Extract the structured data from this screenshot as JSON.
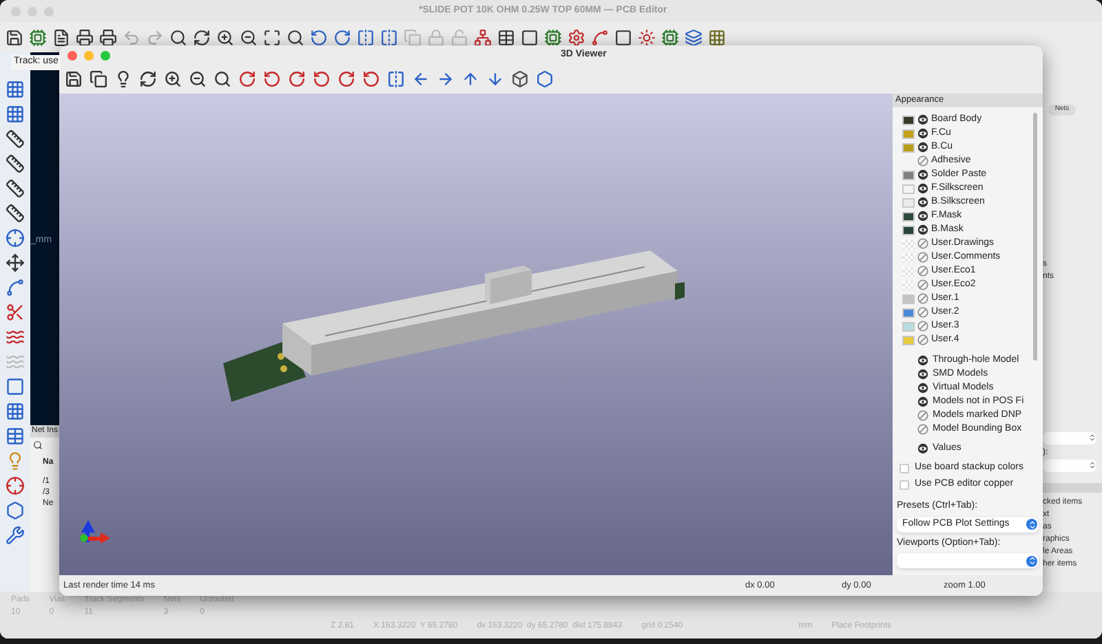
{
  "pcb_editor": {
    "title": "*SLIDE POT 10K OHM 0.25W TOP 60MM — PCB Editor",
    "tooltip": "Track: use",
    "canvas_label": "_mm",
    "net_inspector": {
      "title": "Net Ins",
      "column": "Na",
      "rows": [
        "/1",
        "/3",
        "Ne"
      ]
    },
    "right_panel": {
      "tab": "Nets",
      "fragments": [
        "s",
        "nts"
      ],
      "select_label": "):",
      "list_fragments": [
        "cked items",
        "xt",
        "as",
        "raphics",
        "le Areas",
        "her items"
      ]
    },
    "stats": [
      {
        "label": "Pads",
        "value": "10"
      },
      {
        "label": "Vias",
        "value": "0"
      },
      {
        "label": "Track Segments",
        "value": "11"
      },
      {
        "label": "Nets",
        "value": "3"
      },
      {
        "label": "Unrouted",
        "value": "0"
      }
    ],
    "status": [
      "Z 2.81",
      "X 163.3220  Y 65.2780",
      "dx 163.3220  dy 65.2780  dist 175.8843",
      "grid 0.2540",
      "mm",
      "Place Footprints"
    ]
  },
  "viewer": {
    "title": "3D Viewer",
    "appearance_title": "Appearance",
    "layers": [
      {
        "kind": "solid",
        "color": "#3b3a2a",
        "name": "Board Body",
        "visible": true
      },
      {
        "kind": "solid",
        "color": "#c4a21a",
        "name": "F.Cu",
        "visible": true
      },
      {
        "kind": "solid",
        "color": "#b89e1c",
        "name": "B.Cu",
        "visible": true
      },
      {
        "kind": "none",
        "name": "Adhesive",
        "visible": false
      },
      {
        "kind": "solid",
        "color": "#808080",
        "name": "Solder Paste",
        "visible": true
      },
      {
        "kind": "solid",
        "color": "#f2f2f2",
        "name": "F.Silkscreen",
        "visible": true
      },
      {
        "kind": "solid",
        "color": "#ebebeb",
        "name": "B.Silkscreen",
        "visible": true
      },
      {
        "kind": "solid",
        "color": "#2e4a3c",
        "name": "F.Mask",
        "visible": true
      },
      {
        "kind": "solid",
        "color": "#2a463c",
        "name": "B.Mask",
        "visible": true
      },
      {
        "kind": "checker",
        "name": "User.Drawings",
        "visible": false
      },
      {
        "kind": "checker",
        "name": "User.Comments",
        "visible": false
      },
      {
        "kind": "checker",
        "name": "User.Eco1",
        "visible": false
      },
      {
        "kind": "checker",
        "name": "User.Eco2",
        "visible": false
      },
      {
        "kind": "solid",
        "color": "#c4c4c4",
        "name": "User.1",
        "visible": false
      },
      {
        "kind": "solid",
        "color": "#4a8ad8",
        "name": "User.2",
        "visible": false
      },
      {
        "kind": "solid",
        "color": "#b8dce0",
        "name": "User.3",
        "visible": false
      },
      {
        "kind": "solid",
        "color": "#e8cc40",
        "name": "User.4",
        "visible": false
      }
    ],
    "models": [
      {
        "name": "Through-hole Model",
        "visible": true
      },
      {
        "name": "SMD Models",
        "visible": true
      },
      {
        "name": "Virtual Models",
        "visible": true
      },
      {
        "name": "Models not in POS Fi",
        "visible": true
      },
      {
        "name": "Models marked DNP",
        "visible": false
      },
      {
        "name": "Model Bounding Box",
        "visible": false
      }
    ],
    "values": {
      "name": "Values",
      "visible": true
    },
    "options": [
      {
        "label": "Use board stackup colors",
        "checked": false
      },
      {
        "label": "Use PCB editor copper",
        "checked": false
      }
    ],
    "presets_label": "Presets (Ctrl+Tab):",
    "preset_value": "Follow PCB Plot Settings",
    "viewports_label": "Viewports (Option+Tab):",
    "status": {
      "render_time": "Last render time 14 ms",
      "dx": "dx 0.00",
      "dy": "dy 0.00",
      "zoom": "zoom 1.00"
    }
  }
}
